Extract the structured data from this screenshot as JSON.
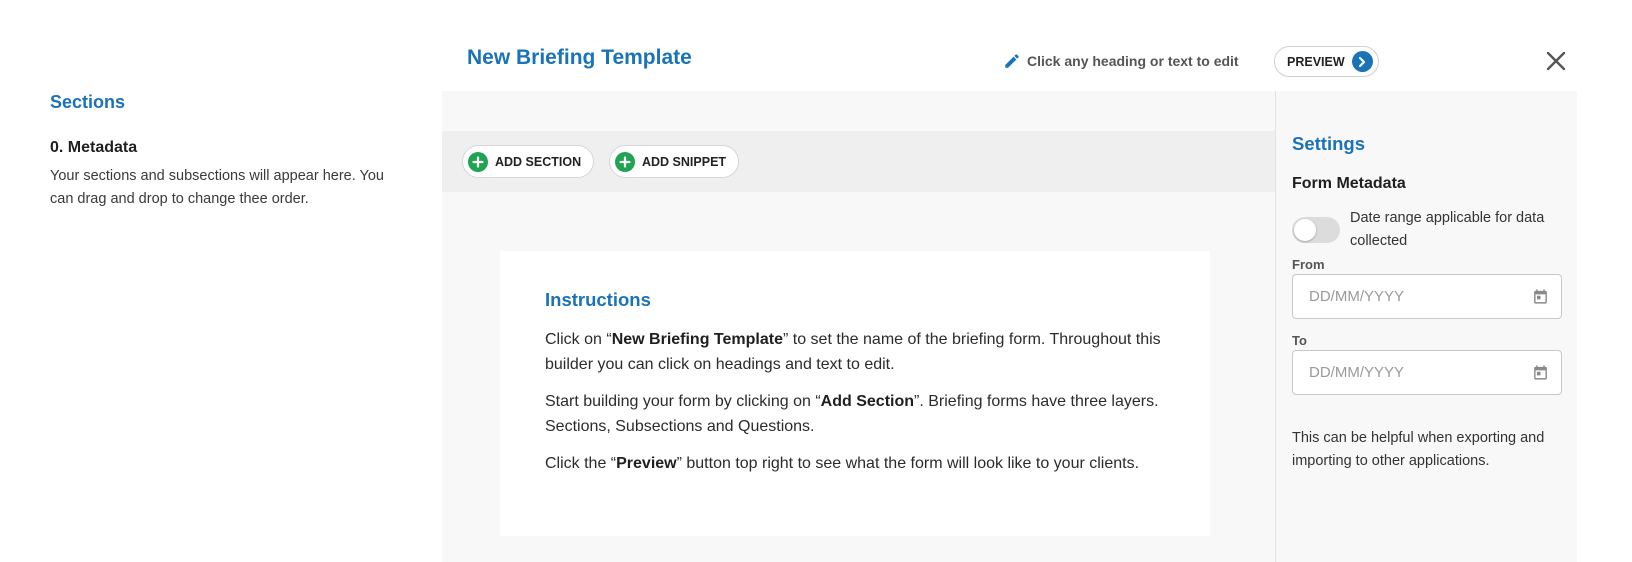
{
  "sidebar": {
    "title": "Sections",
    "item_title": "0. Metadata",
    "item_desc": "Your sections and subsections will appear here. You can drag and drop to change thee order."
  },
  "header": {
    "title": "New Briefing Template",
    "edit_hint": "Click any heading or text to edit",
    "preview_label": "PREVIEW"
  },
  "toolbar": {
    "add_section_label": "ADD SECTION",
    "add_snippet_label": "ADD SNIPPET"
  },
  "instructions": {
    "title": "Instructions",
    "p1_pre": "Click on “",
    "p1_bold": "New Briefing Template",
    "p1_post": "” to set the name of the briefing form. Throughout this builder you can click on headings and text to edit.",
    "p2_pre": "Start building your form by clicking on “",
    "p2_bold": "Add Section",
    "p2_post": "”. Briefing forms have three layers. Sections, Subsections and Questions.",
    "p3_pre": "Click the “",
    "p3_bold": "Preview",
    "p3_post": "” button top right to see what the form will look like to your clients."
  },
  "settings": {
    "title": "Settings",
    "subtitle": "Form Metadata",
    "toggle_label": "Date range applicable for data collected",
    "toggle_on": false,
    "from_label": "From",
    "from_placeholder": "DD/MM/YYYY",
    "to_label": "To",
    "to_placeholder": "DD/MM/YYYY",
    "note": "This can be helpful when exporting and importing to other applications."
  },
  "icons": {
    "edit": "pencil-icon",
    "preview": "chevron-right-icon",
    "close": "close-icon",
    "add": "plus-icon",
    "calendar": "calendar-icon"
  },
  "colors": {
    "accent": "#1a73b8",
    "add_green": "#20a352",
    "panel_bg": "#f8f8f8",
    "toolbar_bg": "#efefef"
  }
}
